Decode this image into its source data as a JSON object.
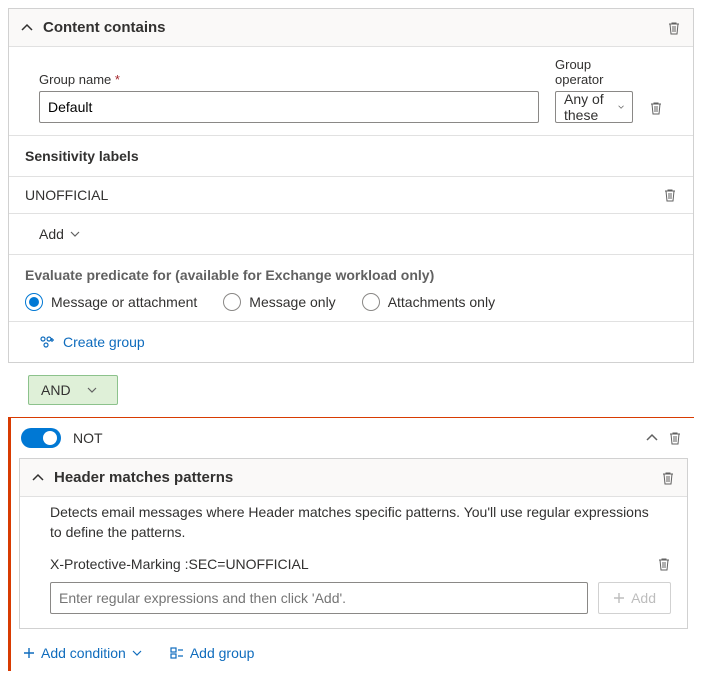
{
  "contentPanel": {
    "title": "Content contains",
    "groupNameLabel": "Group name",
    "groupNameValue": "Default",
    "groupOperatorLabel": "Group operator",
    "groupOperatorValue": "Any of these",
    "sensitivityHeader": "Sensitivity labels",
    "labels": {
      "0": "UNOFFICIAL"
    },
    "addLabel": "Add",
    "evaluateHint": "Evaluate predicate for (available for Exchange workload only)",
    "radio": {
      "messageOrAttachment": "Message or attachment",
      "messageOnly": "Message only",
      "attachmentsOnly": "Attachments only"
    },
    "createGroupLabel": "Create group"
  },
  "operatorPill": "AND",
  "notBlock": {
    "notLabel": "NOT",
    "headerPanel": {
      "title": "Header matches patterns",
      "description": "Detects email messages where Header matches specific patterns. You'll use regular expressions to define the patterns.",
      "patterns": {
        "0": "X-Protective-Marking :SEC=UNOFFICIAL"
      },
      "regexPlaceholder": "Enter regular expressions and then click 'Add'.",
      "addButton": "Add"
    },
    "footer": {
      "addCondition": "Add condition",
      "addGroup": "Add group"
    }
  }
}
